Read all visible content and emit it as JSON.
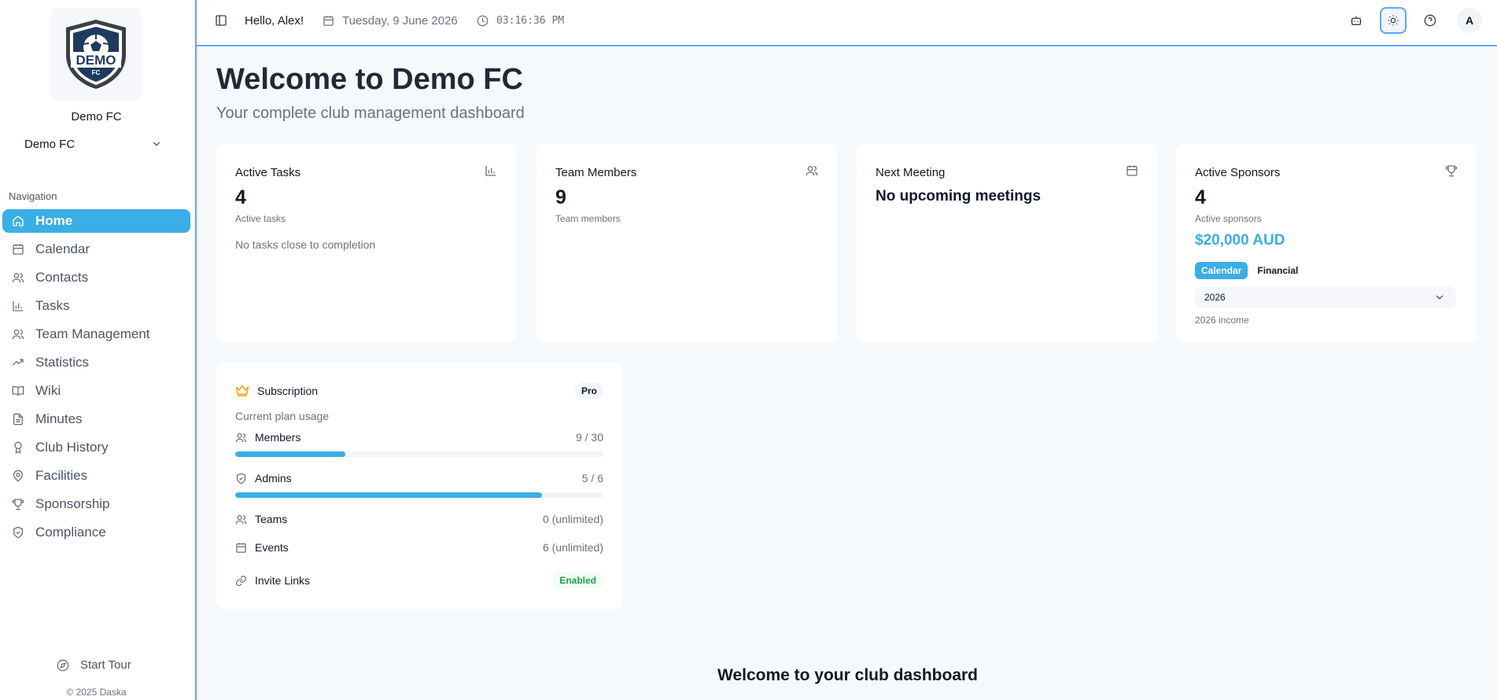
{
  "sidebar": {
    "club_name": "Demo FC",
    "club_select_value": "Demo FC",
    "nav_heading": "Navigation",
    "items": [
      {
        "label": "Home",
        "icon": "home-icon",
        "active": true
      },
      {
        "label": "Calendar",
        "icon": "calendar-icon"
      },
      {
        "label": "Contacts",
        "icon": "users-icon"
      },
      {
        "label": "Tasks",
        "icon": "bar-chart-icon"
      },
      {
        "label": "Team Management",
        "icon": "users-icon"
      },
      {
        "label": "Statistics",
        "icon": "trending-up-icon"
      },
      {
        "label": "Wiki",
        "icon": "book-open-icon"
      },
      {
        "label": "Minutes",
        "icon": "file-text-icon"
      },
      {
        "label": "Club History",
        "icon": "award-icon"
      },
      {
        "label": "Facilities",
        "icon": "map-pin-icon"
      },
      {
        "label": "Sponsorship",
        "icon": "trophy-icon"
      },
      {
        "label": "Compliance",
        "icon": "shield-check-icon"
      }
    ],
    "start_tour": "Start Tour",
    "copyright": "© 2025 Daska"
  },
  "logo": {
    "text": "DEMO",
    "sub": "FC",
    "color": "#1e3a5f"
  },
  "header": {
    "greeting": "Hello, Alex!",
    "date": "Tuesday, 9 June 2026",
    "time": "03:16:36 PM",
    "avatar_initial": "A",
    "icons": [
      "sidebar-toggle-icon",
      "calendar-icon",
      "clock-icon",
      "bot-icon",
      "sun-icon",
      "help-circle-icon"
    ]
  },
  "main": {
    "title": "Welcome to Demo FC",
    "subtitle": "Your complete club management dashboard",
    "cards": {
      "tasks": {
        "title": "Active Tasks",
        "value": "4",
        "caption": "Active tasks",
        "note": "No tasks close to completion",
        "icon": "bar-chart-icon"
      },
      "members": {
        "title": "Team Members",
        "value": "9",
        "caption": "Team members",
        "icon": "users-icon"
      },
      "meeting": {
        "title": "Next Meeting",
        "value": "No upcoming meetings",
        "icon": "calendar-icon"
      },
      "sponsors": {
        "title": "Active Sponsors",
        "value": "4",
        "caption": "Active sponsors",
        "amount": "$20,000 AUD",
        "tab_calendar": "Calendar",
        "tab_financial": "Financial",
        "year": "2026",
        "year_caption": "2026 income",
        "icon": "trophy-icon"
      }
    },
    "subscription": {
      "title": "Subscription",
      "plan_badge": "Pro",
      "caption": "Current plan usage",
      "members": {
        "label": "Members",
        "value": "9 / 30",
        "fraction": 0.3
      },
      "admins": {
        "label": "Admins",
        "value": "5 / 6",
        "fraction": 0.8333
      },
      "teams": {
        "label": "Teams",
        "value": "0 (unlimited)"
      },
      "events": {
        "label": "Events",
        "value": "6 (unlimited)"
      },
      "invite_links": {
        "label": "Invite Links",
        "status": "Enabled"
      }
    },
    "footer_heading": "Welcome to your club dashboard"
  },
  "colors": {
    "accent": "#3aaee6",
    "active_border": "#60a5fa",
    "enabled": "#16a34a",
    "crown": "#f59e0b"
  }
}
